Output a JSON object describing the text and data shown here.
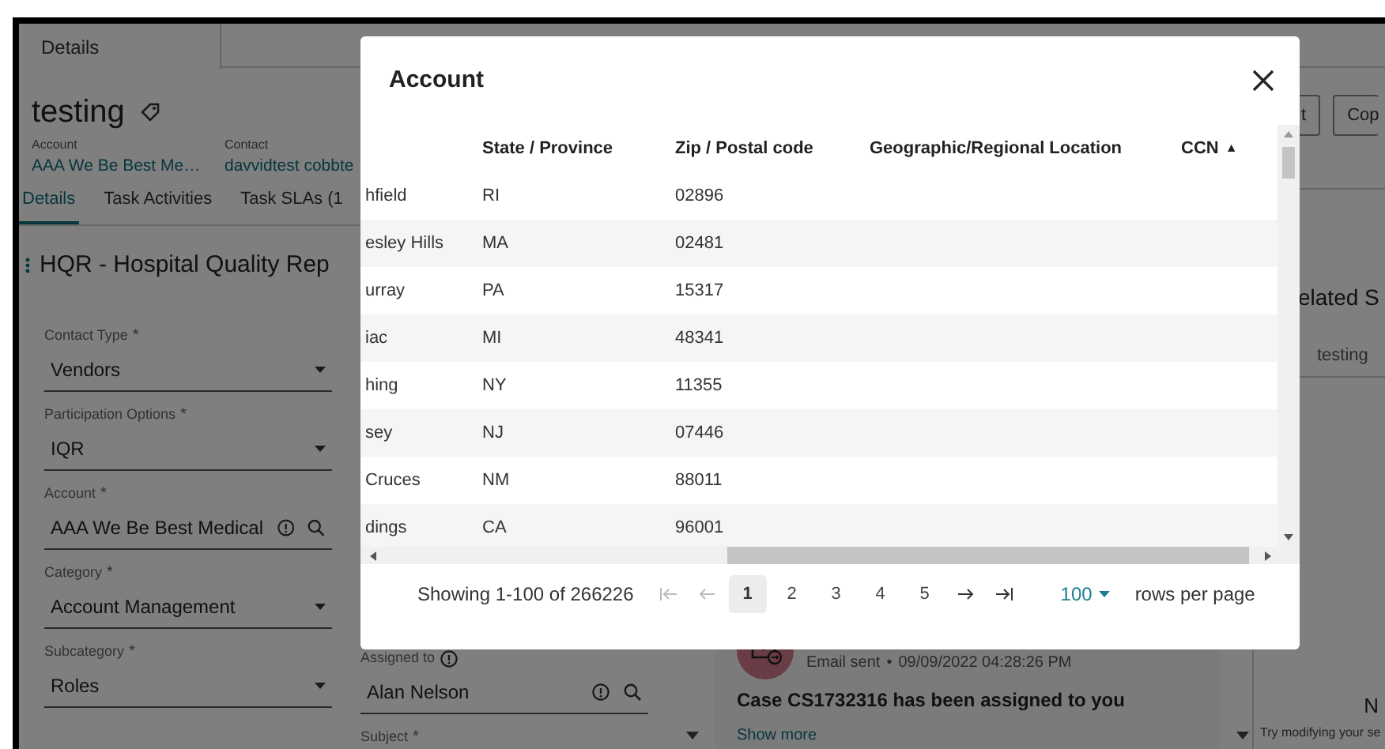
{
  "top_tabs": [
    {
      "label": "Details",
      "selected": true
    }
  ],
  "record": {
    "title": "testing",
    "fields": [
      {
        "label": "Account",
        "value": "AAA We Be Best Me…"
      },
      {
        "label": "Contact",
        "value": "davvidtest cobbte"
      }
    ]
  },
  "header_buttons": [
    "t",
    "Cop"
  ],
  "tabs": [
    {
      "label": "Details",
      "selected": true
    },
    {
      "label": "Task Activities",
      "selected": false
    },
    {
      "label": "Task SLAs (1",
      "selected": false
    }
  ],
  "section_title": "HQR - Hospital Quality Rep",
  "form": {
    "left": [
      {
        "label": "Contact Type",
        "required": true,
        "required_mark": "*",
        "kind": "dropdown",
        "value": "Vendors"
      },
      {
        "label": "Participation Options",
        "required": true,
        "required_mark": "*",
        "kind": "dropdown",
        "value": "IQR"
      },
      {
        "label": "Account",
        "required": true,
        "required_mark": "*",
        "kind": "lookup",
        "value": "AAA We Be Best Medical"
      },
      {
        "label": "Category",
        "required": true,
        "required_mark": "*",
        "kind": "dropdown",
        "value": "Account Management"
      },
      {
        "label": "Subcategory",
        "required": true,
        "required_mark": "*",
        "kind": "dropdown",
        "value": "Roles"
      }
    ],
    "right": [
      {
        "label": "Assigned to",
        "required": false,
        "info": true,
        "kind": "lookup",
        "value": "Alan Nelson"
      },
      {
        "label": "Subject",
        "required": true,
        "required_mark": "*",
        "kind": "label"
      }
    ]
  },
  "activity": {
    "meta": "Email sent",
    "separator": "•",
    "time": "09/09/2022 04:28:26 PM",
    "message": "Case CS1732316 has been assigned to you",
    "link": "Show more"
  },
  "related": {
    "title": "elated S",
    "tabs": [
      {
        "label": "testing"
      }
    ],
    "empty_title": "N",
    "empty_text": "Try modifying your se"
  },
  "modal": {
    "title": "Account",
    "columns": [
      {
        "label": "State / Province"
      },
      {
        "label": "Zip / Postal code"
      },
      {
        "label": "Geographic/Regional Location"
      },
      {
        "label": "CCN",
        "sorted": true,
        "sort_indicator": "▲"
      }
    ],
    "rows": [
      {
        "column_1": "hfield",
        "state_province": "RI",
        "zip_postal_code": "02896"
      },
      {
        "column_1": "esley Hills",
        "state_province": "MA",
        "zip_postal_code": "02481"
      },
      {
        "column_1": "urray",
        "state_province": "PA",
        "zip_postal_code": "15317"
      },
      {
        "column_1": "iac",
        "state_province": "MI",
        "zip_postal_code": "48341"
      },
      {
        "column_1": "hing",
        "state_province": "NY",
        "zip_postal_code": "11355"
      },
      {
        "column_1": "sey",
        "state_province": "NJ",
        "zip_postal_code": "07446"
      },
      {
        "column_1": "Cruces",
        "state_province": "NM",
        "zip_postal_code": "88011"
      },
      {
        "column_1": "dings",
        "state_province": "CA",
        "zip_postal_code": "96001"
      }
    ],
    "summary": "Showing 1-100 of 266226",
    "pages": [
      {
        "label": "1",
        "selected": true
      },
      {
        "label": "2",
        "selected": false
      },
      {
        "label": "3",
        "selected": false
      },
      {
        "label": "4",
        "selected": false
      },
      {
        "label": "5",
        "selected": false
      }
    ],
    "page_size": "100",
    "page_size_label": "rows per page"
  }
}
